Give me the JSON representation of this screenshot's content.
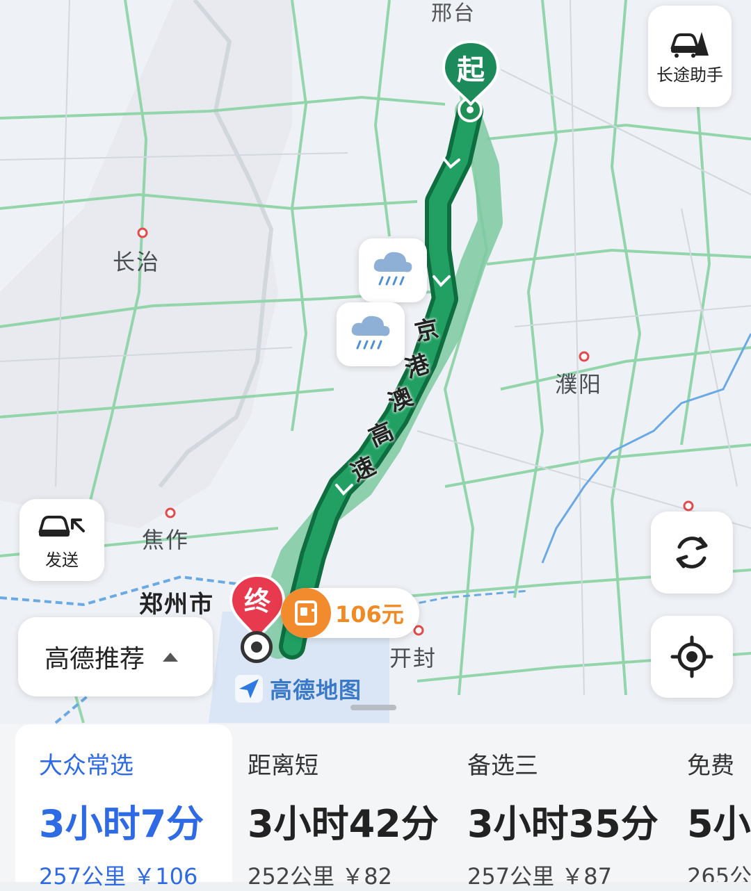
{
  "map": {
    "labels": {
      "xingtai": "邢台",
      "changzhi": "长治",
      "puyang": "濮阳",
      "jiaozuo": "焦作",
      "zhengzhou": "郑州市",
      "kaifeng": "开封"
    },
    "road_name": [
      "京",
      "港",
      "澳",
      "高",
      "速"
    ],
    "start_marker": "起",
    "end_marker": "终",
    "toll": "106元",
    "brand": "高德地图"
  },
  "controls": {
    "long_trip_label": "长途助手",
    "send_label": "发送",
    "refresh_icon": "refresh-icon",
    "locate_icon": "locate-icon"
  },
  "route_selector": {
    "label": "高德推荐"
  },
  "routes": [
    {
      "name": "大众常选",
      "time": "3小时7分",
      "meta": "257公里 ￥106",
      "selected": true
    },
    {
      "name": "距离短",
      "time": "3小时42分",
      "meta": "252公里 ￥82"
    },
    {
      "name": "备选三",
      "time": "3小时35分",
      "meta": "257公里 ￥87"
    },
    {
      "name": "免费",
      "time": "5小",
      "meta": "265公"
    }
  ],
  "colors": {
    "route_primary": "#1f8f55",
    "route_alt": "#7cc9a0",
    "accent_blue": "#2f6ae5",
    "toll_orange": "#f28a2e",
    "end_red": "#e83a4f"
  }
}
